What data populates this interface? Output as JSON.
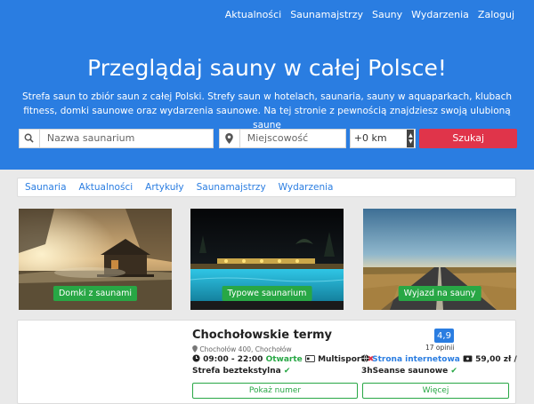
{
  "topnav": {
    "items": [
      "Aktualności",
      "Saunamajstrzy",
      "Sauny",
      "Wydarzenia",
      "Zaloguj"
    ]
  },
  "hero": {
    "title": "Przeglądaj sauny w całej Polsce!",
    "description": "Strefa saun to zbiór saun z całej Polski. Strefy saun w hotelach, saunaria, sauny w aquaparkach, klubach fitness, domki saunowe oraz wydarzenia saunowe. Na tej stronie z pewnością znajdziesz swoją ulubioną saunę"
  },
  "search": {
    "name_placeholder": "Nazwa saunarium",
    "city_placeholder": "Miejscowość",
    "distance_value": "+0 km",
    "submit_label": "Szukaj"
  },
  "subnav": {
    "items": [
      "Saunaria",
      "Aktualności",
      "Artykuły",
      "Saunamajstrzy",
      "Wydarzenia"
    ]
  },
  "cards": [
    {
      "label": "Domki z saunami"
    },
    {
      "label": "Typowe saunarium"
    },
    {
      "label": "Wyjazd na sauny"
    }
  ],
  "listing": {
    "title": "Chochołowskie termy",
    "address": "Chochołów 400, Chochołów",
    "hours": "09:00 - 22:00",
    "open_status": "Otwarte",
    "multisport": "Multisport",
    "website": "Strona internetowa",
    "price": "59,00 zł /",
    "textile_free": "Strefa beztekstylna",
    "sessions": "3hSeanse saunowe",
    "rating": "4,9",
    "reviews": "17 opinii",
    "show_number_label": "Pokaż numer",
    "more_label": "Więcej"
  },
  "colors": {
    "brand_blue": "#2a7de1",
    "search_button": "#e0344a",
    "green": "#28a745"
  }
}
